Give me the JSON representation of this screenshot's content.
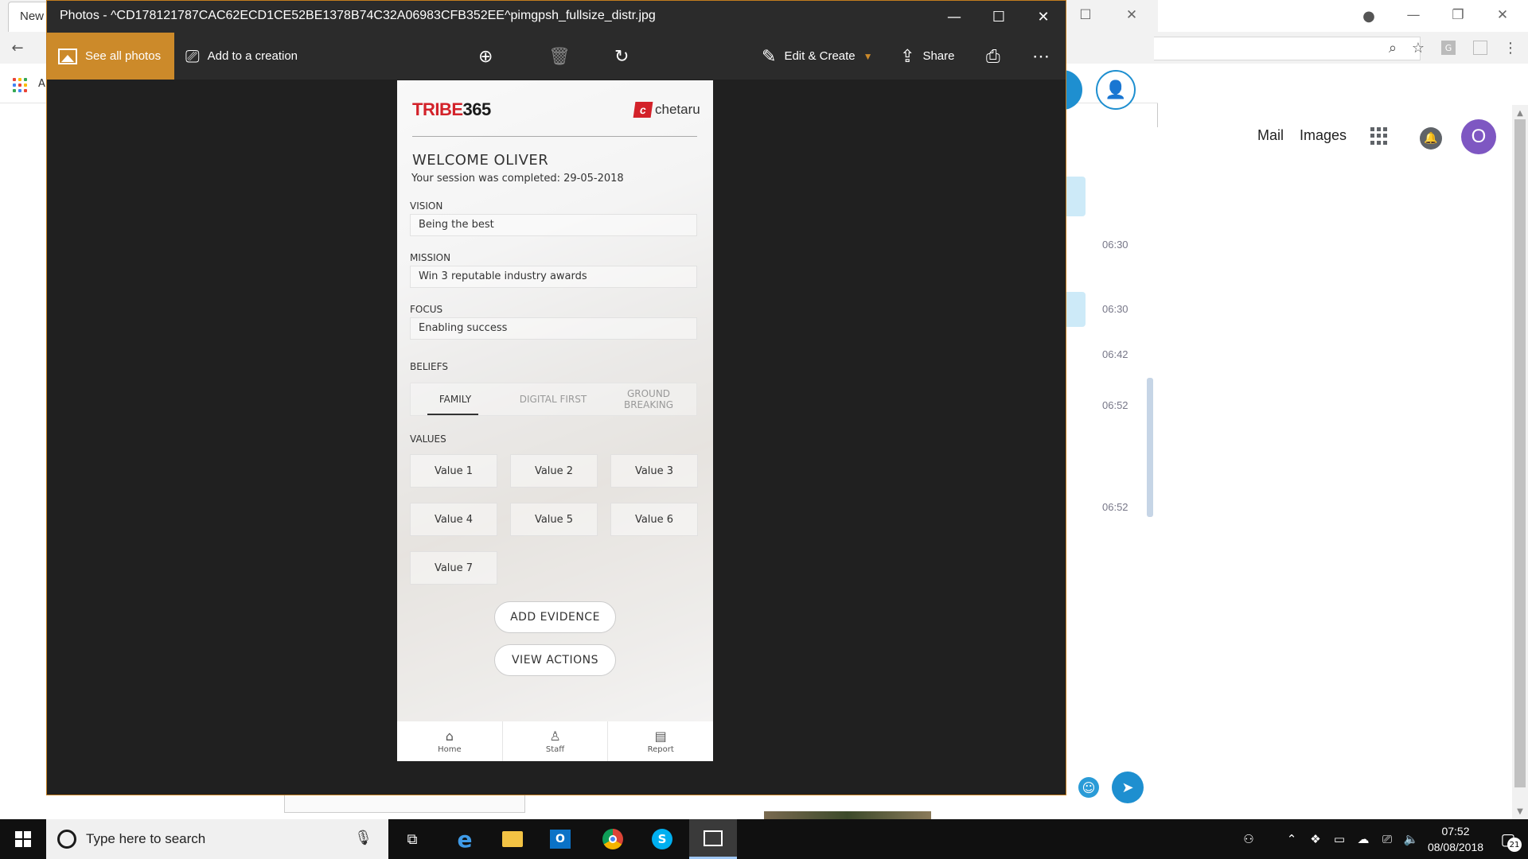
{
  "chrome": {
    "tab_label": "New",
    "bookmark_label": "A"
  },
  "google_header": {
    "mail": "Mail",
    "images": "Images",
    "avatar_letter": "O"
  },
  "chat": {
    "times": [
      "06:30",
      "06:30",
      "06:42",
      "06:52",
      "06:52"
    ],
    "bubble_color": "#cdeaf8",
    "accent": "#1e8fd0"
  },
  "photos": {
    "title": "Photos - ^CD178121787CAC62ECD1CE52BE1378B74C32A06983CFB352EE^pimgpsh_fullsize_distr.jpg",
    "accent": "#cc8a2a",
    "toolbar": {
      "see_all": "See all photos",
      "add_to_creation": "Add to a creation",
      "edit_create": "Edit & Create",
      "share": "Share"
    }
  },
  "app": {
    "logo_tribe": "TRIBE",
    "logo_365": "365",
    "logo_chetaru": "chetaru",
    "welcome": "WELCOME OLIVER",
    "session": "Your session was completed: 29-05-2018",
    "vision_label": "VISION",
    "vision_value": "Being the best",
    "mission_label": "MISSION",
    "mission_value": "Win 3 reputable industry awards",
    "focus_label": "FOCUS",
    "focus_value": "Enabling success",
    "beliefs_label": "BELIEFS",
    "beliefs": [
      "FAMILY",
      "DIGITAL FIRST",
      "GROUND BREAKING"
    ],
    "values_label": "VALUES",
    "values": [
      "Value 1",
      "Value 2",
      "Value 3",
      "Value 4",
      "Value 5",
      "Value 6",
      "Value 7"
    ],
    "add_evidence": "ADD EVIDENCE",
    "view_actions": "VIEW ACTIONS",
    "nav": [
      "Home",
      "Staff",
      "Report"
    ]
  },
  "taskbar": {
    "search_placeholder": "Type here to search",
    "time": "07:52",
    "date": "08/08/2018",
    "notifications": "21"
  }
}
